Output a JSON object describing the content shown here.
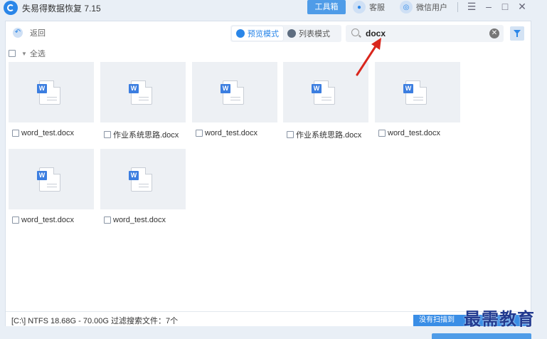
{
  "window": {
    "app_title": "失易得数据恢复 7.15",
    "toolbox_label": "工具箱",
    "service_label": "客服",
    "wechat_user_label": "微信用户"
  },
  "toolbar": {
    "back_label": "返回",
    "preview_mode_label": "预览模式",
    "list_mode_label": "列表模式",
    "search_value": "docx"
  },
  "select_all_label": "全选",
  "files": [
    {
      "name": "word_test.docx"
    },
    {
      "name": "作业系统思路.docx"
    },
    {
      "name": "word_test.docx"
    },
    {
      "name": "作业系统思路.docx"
    },
    {
      "name": "word_test.docx"
    },
    {
      "name": "word_test.docx"
    },
    {
      "name": "word_test.docx"
    }
  ],
  "status": {
    "text": "[C:\\] NTFS 18.68G - 70.00G 过滤搜索文件：7个",
    "scan_hint": "没有扫描到"
  },
  "watermark": "最需教育",
  "colors": {
    "accent": "#2a86e8",
    "arrow": "#d9261c"
  }
}
